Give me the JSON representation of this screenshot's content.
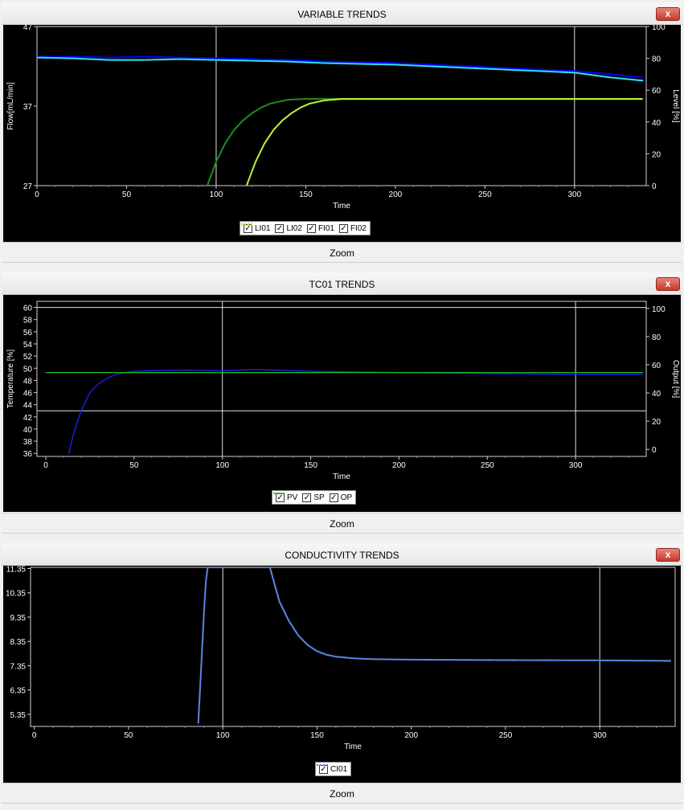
{
  "panels": [
    {
      "id": "variable",
      "title": "VARIABLE TRENDS",
      "zoom_label": "Zoom",
      "close_label": "x",
      "legend": [
        {
          "name": "LI01",
          "color": "#0000ff",
          "dotted": true
        },
        {
          "name": "LI02",
          "color": "#33e0f0",
          "dotted": true
        },
        {
          "name": "FI01",
          "color": "#1e8a1e",
          "dotted": true
        },
        {
          "name": "FI02",
          "color": "#b8f23a",
          "dotted": true
        }
      ]
    },
    {
      "id": "tc01",
      "title": "TC01 TRENDS",
      "zoom_label": "Zoom",
      "close_label": "x",
      "legend": [
        {
          "name": "PV",
          "color": "#e02020",
          "dotted": false
        },
        {
          "name": "SP",
          "color": "#2020ff",
          "dotted": false
        },
        {
          "name": "OP",
          "color": "#20c020",
          "dotted": false
        }
      ]
    },
    {
      "id": "conductivity",
      "title": "CONDUCTIVITY TRENDS",
      "zoom_label": "Zoom",
      "close_label": "x",
      "legend": [
        {
          "name": "CI01",
          "color": "#5b86e0",
          "dotted": true
        }
      ]
    }
  ],
  "chart_data": [
    {
      "type": "line",
      "xlabel": "Time",
      "ylabel": "Flow[mL/min]",
      "y2label": "Level [%]",
      "xlim": [
        0,
        340
      ],
      "ylim": [
        27,
        47
      ],
      "y2lim": [
        0,
        100
      ],
      "xticks": [
        0,
        50,
        100,
        150,
        200,
        250,
        300
      ],
      "yticks": [
        27,
        37,
        47
      ],
      "y2ticks": [
        0,
        20,
        40,
        60,
        80,
        100
      ],
      "vlines": [
        100,
        300
      ],
      "grid": false,
      "legend_position": "bottom",
      "series": [
        {
          "name": "LI01",
          "axis": "y2",
          "color": "#0000ff",
          "x": [
            0,
            20,
            40,
            60,
            80,
            100,
            120,
            140,
            160,
            180,
            200,
            220,
            240,
            260,
            280,
            300,
            320,
            338
          ],
          "y": [
            81,
            81,
            80.5,
            81,
            80.5,
            80,
            79.5,
            79,
            78,
            77.5,
            77,
            76,
            75,
            74,
            73,
            72,
            70,
            68
          ]
        },
        {
          "name": "LI02",
          "axis": "y2",
          "color": "#33e0f0",
          "x": [
            0,
            20,
            40,
            60,
            80,
            100,
            120,
            140,
            160,
            180,
            200,
            220,
            240,
            260,
            280,
            300,
            320,
            338
          ],
          "y": [
            80.5,
            80,
            79,
            79,
            79.5,
            79,
            78.5,
            78,
            77,
            76.5,
            76,
            75,
            74,
            73,
            72,
            71,
            68,
            66
          ]
        },
        {
          "name": "FI01",
          "axis": "y1",
          "color": "#1e8a1e",
          "x": [
            95,
            100,
            105,
            110,
            115,
            120,
            125,
            130,
            140,
            150,
            160,
            180,
            200,
            250,
            300,
            338
          ],
          "y": [
            27,
            30,
            32.3,
            34,
            35.2,
            36.1,
            36.8,
            37.3,
            37.8,
            37.9,
            37.9,
            37.9,
            37.9,
            37.9,
            37.9,
            37.9
          ]
        },
        {
          "name": "FI02",
          "axis": "y1",
          "color": "#b8f23a",
          "x": [
            117,
            122,
            127,
            132,
            137,
            142,
            147,
            152,
            160,
            170,
            180,
            200,
            250,
            300,
            338
          ],
          "y": [
            27,
            30,
            32.3,
            34,
            35.2,
            36.1,
            36.8,
            37.3,
            37.7,
            37.9,
            37.9,
            37.9,
            37.9,
            37.9,
            37.9
          ]
        }
      ]
    },
    {
      "type": "line",
      "xlabel": "Time",
      "ylabel": "Temperature [%]",
      "y2label": "Output [%]",
      "xlim": [
        -5,
        340
      ],
      "ylim": [
        35.5,
        61
      ],
      "y2lim": [
        -5,
        105
      ],
      "xticks": [
        0,
        50,
        100,
        150,
        200,
        250,
        300
      ],
      "yticks": [
        36,
        38,
        40,
        42,
        44,
        46,
        48,
        50,
        52,
        54,
        56,
        58,
        60
      ],
      "y2ticks": [
        0,
        20,
        40,
        60,
        80,
        100
      ],
      "vlines": [
        100,
        300
      ],
      "hlines": [
        43
      ],
      "grid": false,
      "legend_position": "bottom",
      "series": [
        {
          "name": "SP",
          "axis": "y1",
          "color": "#2020ff",
          "x": [
            13,
            16,
            20,
            25,
            30,
            35,
            40,
            45,
            50,
            60,
            80,
            100,
            120,
            150,
            200,
            250,
            300,
            338
          ],
          "y": [
            36,
            39.5,
            43,
            46,
            47.5,
            48.4,
            49,
            49.3,
            49.5,
            49.6,
            49.7,
            49.6,
            49.8,
            49.5,
            49.3,
            49.1,
            49,
            49
          ]
        },
        {
          "name": "OP",
          "axis": "y1",
          "color": "#20c020",
          "x": [
            0,
            338
          ],
          "y": [
            49.3,
            49.3
          ]
        }
      ]
    },
    {
      "type": "line",
      "xlabel": "Time",
      "ylabel": "",
      "xlim": [
        -2,
        340
      ],
      "ylim": [
        4.85,
        11.4
      ],
      "xticks": [
        0,
        50,
        100,
        150,
        200,
        250,
        300
      ],
      "yticks": [
        5.35,
        6.35,
        7.35,
        8.35,
        9.35,
        10.35,
        11.35
      ],
      "vlines": [
        100,
        300
      ],
      "grid": false,
      "legend_position": "bottom",
      "series": [
        {
          "name": "CI01",
          "axis": "y1",
          "color": "#5b86e0",
          "x": [
            87,
            88,
            89,
            90,
            91,
            92,
            125,
            130,
            135,
            140,
            145,
            150,
            155,
            160,
            170,
            180,
            200,
            250,
            300,
            338
          ],
          "y": [
            5.0,
            6.5,
            8.0,
            9.5,
            10.8,
            11.4,
            11.4,
            10.0,
            9.2,
            8.6,
            8.2,
            7.95,
            7.8,
            7.72,
            7.65,
            7.62,
            7.6,
            7.58,
            7.57,
            7.55
          ]
        }
      ]
    }
  ]
}
